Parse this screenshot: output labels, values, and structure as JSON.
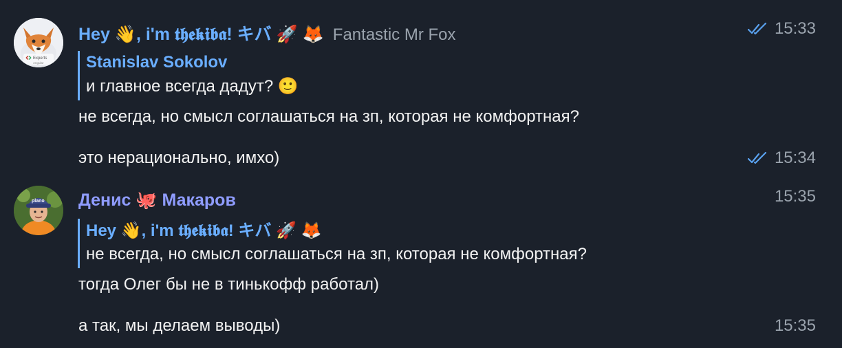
{
  "messages_group_1": {
    "sender": {
      "name": "Hey",
      "name_rest": ", i'm 𝖙𝖍𝖊𝖐𝖎𝖇𝖆! キバ",
      "emoji_wave": "👋",
      "emoji_rocket": "🚀",
      "emoji_fox": "🦊",
      "badge": "Fantastic Mr Fox",
      "avatar_text_1": "Experts",
      "avatar_text_2": "Angular"
    },
    "reply": {
      "author": "Stanislav Sokolov",
      "text": "и главное всегда дадут?",
      "emoji": "🙂"
    },
    "message_1": "не всегда, но смысл соглашаться на зп, которая не комфортная?",
    "message_2": "это нерационально, имхо)",
    "time_1": "15:33",
    "time_2": "15:34"
  },
  "messages_group_2": {
    "sender": {
      "first": "Денис",
      "emoji_octopus": "🐙",
      "last": "Макаров",
      "avatar_cap_text": "plano"
    },
    "reply": {
      "author": "Hey",
      "author_rest": ", i'm 𝖙𝖍𝖊𝖐𝖎𝖇𝖆! キバ",
      "emoji_wave": "👋",
      "emoji_rocket": "🚀",
      "emoji_fox": "🦊",
      "text": "не всегда, но смысл соглашаться на зп, которая не комфортная?"
    },
    "message_1": "тогда Олег бы не в тинькофф работал)",
    "message_2": "а так, мы делаем выводы)",
    "time_1": "15:35",
    "time_2": "15:35"
  },
  "colors": {
    "background": "#1b212b",
    "sender_1": "#6aaeff",
    "sender_2": "#8f9cff",
    "reply_bar": "#6aaeff",
    "timestamp": "#9aa3ad",
    "read_check": "#5aa2f0"
  },
  "icons": {
    "read_receipt": "double-check-icon"
  }
}
